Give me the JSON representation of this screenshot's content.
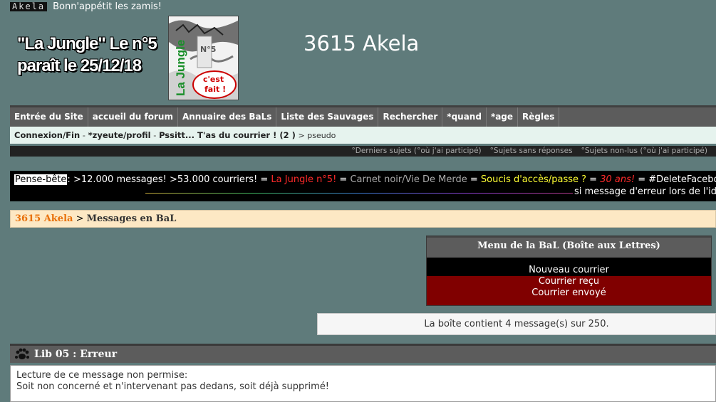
{
  "top": {
    "logo_text": "Akela",
    "tagline": "Bonn'appétit les zamis!"
  },
  "promo": {
    "line1": "\"La Jungle\" Le n°5",
    "line2": "paraît le 25/12/18"
  },
  "cover": {
    "vertical_title": "La Jungle",
    "number": "N°5",
    "stamp": "c'est fait !"
  },
  "site_title": "3615 Akela",
  "nav": [
    "Entrée du Site",
    "accueil du forum",
    "Annuaire des BaLs",
    "Liste des Sauvages",
    "Rechercher",
    "*quand",
    "*age",
    "Règles"
  ],
  "userbar": {
    "login": "Connexion/Fin",
    "sep": " - ",
    "profile": "*zyeute/profil",
    "mail_prefix": "Pssitt... T'as du courrier ! (",
    "mail_count": "2",
    "mail_suffix": " )",
    "pseudo": "pseudo"
  },
  "subbar": [
    "°Derniers sujets (°où j'ai participé)",
    "°Sujets sans réponses",
    "°Sujets non-lus (°où j'ai participé)"
  ],
  "ticker": {
    "label": "Pense-bête",
    "colon": ":",
    "t1": " >12.000 messages! >53.000 courriers! ",
    "s1": "= ",
    "t2": "La Jungle n°5!",
    "s2": " = ",
    "t3": "Carnet noir/Vie De Merde",
    "s3": " = ",
    "t4": "Soucis d'accès/passe ?",
    "s4": " = ",
    "t5": "30 ans!",
    "s5": " = ",
    "t6": "#DeleteFacebook",
    "line2": "si message d'erreur lors de l'identification"
  },
  "breadcrumb": {
    "home": "3615 Akela",
    "sep": " > ",
    "current": "Messages en BaL"
  },
  "bal_menu": {
    "title": "Menu de la BaL (Boîte aux Lettres)",
    "new": "Nouveau courrier",
    "received": "Courrier reçu",
    "sent": "Courrier envoyé"
  },
  "capacity": "La boîte contient 4 message(s) sur 250.",
  "error": {
    "title": "Lib 05 : Erreur",
    "line1": "Lecture de ce message non permise:",
    "line2": "Soit non concerné et n'intervenant pas dedans, soit déjà supprimé!"
  }
}
